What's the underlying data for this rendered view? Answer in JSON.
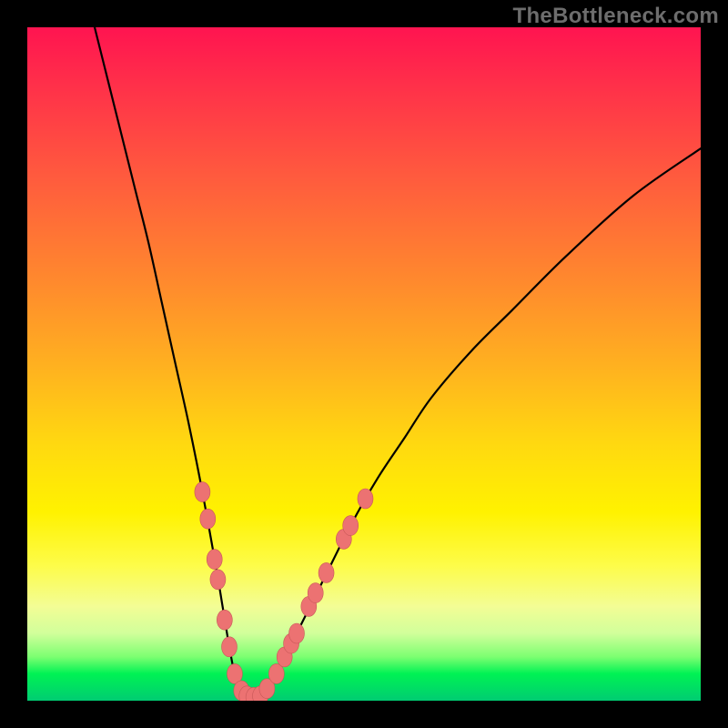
{
  "watermark": "TheBottleneck.com",
  "colors": {
    "frame": "#000000",
    "watermark_text": "#6d6d6d",
    "curve_stroke": "#000000",
    "marker_fill": "#ec7272",
    "marker_stroke": "#c75858"
  },
  "chart_data": {
    "type": "line",
    "title": "",
    "xlabel": "",
    "ylabel": "",
    "xlim": [
      0,
      100
    ],
    "ylim": [
      0,
      100
    ],
    "grid": false,
    "legend": false,
    "background": "vertical-gradient red→orange→yellow→green",
    "series": [
      {
        "name": "bottleneck-curve",
        "stroke": "#000000",
        "x": [
          10,
          12,
          14,
          16,
          18,
          20,
          22,
          24,
          26,
          28,
          29,
          30,
          31,
          32,
          33,
          34,
          35,
          37,
          40,
          44,
          48,
          52,
          56,
          60,
          66,
          72,
          80,
          90,
          100
        ],
        "y": [
          100,
          92,
          84,
          76,
          68,
          59,
          50,
          41,
          31,
          20,
          14,
          8,
          3,
          1,
          0.5,
          0.5,
          1,
          4,
          10,
          18,
          26,
          33,
          39,
          45,
          52,
          58,
          66,
          75,
          82
        ]
      }
    ],
    "markers": {
      "name": "highlight-dots",
      "fill": "#ec7272",
      "points": [
        {
          "x": 26.0,
          "y": 31
        },
        {
          "x": 26.8,
          "y": 27
        },
        {
          "x": 27.8,
          "y": 21
        },
        {
          "x": 28.3,
          "y": 18
        },
        {
          "x": 29.3,
          "y": 12
        },
        {
          "x": 30.0,
          "y": 8
        },
        {
          "x": 30.8,
          "y": 4
        },
        {
          "x": 31.8,
          "y": 1.5
        },
        {
          "x": 32.6,
          "y": 0.7
        },
        {
          "x": 33.6,
          "y": 0.5
        },
        {
          "x": 34.6,
          "y": 0.7
        },
        {
          "x": 35.6,
          "y": 1.8
        },
        {
          "x": 37.0,
          "y": 4
        },
        {
          "x": 38.2,
          "y": 6.5
        },
        {
          "x": 39.2,
          "y": 8.5
        },
        {
          "x": 40.0,
          "y": 10
        },
        {
          "x": 41.8,
          "y": 14
        },
        {
          "x": 42.8,
          "y": 16
        },
        {
          "x": 44.4,
          "y": 19
        },
        {
          "x": 47.0,
          "y": 24
        },
        {
          "x": 48.0,
          "y": 26
        },
        {
          "x": 50.2,
          "y": 30
        }
      ]
    }
  }
}
